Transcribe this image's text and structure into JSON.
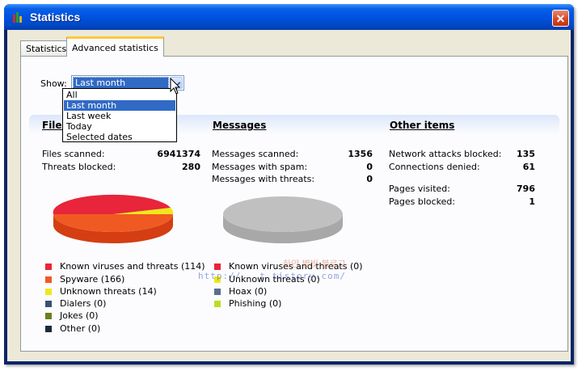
{
  "window": {
    "title": "Statistics"
  },
  "tabs": [
    {
      "label": "Statistics"
    },
    {
      "label": "Advanced statistics"
    }
  ],
  "show": {
    "label": "Show:",
    "selected": "Last month",
    "options": [
      "All",
      "Last month",
      "Last week",
      "Today",
      "Selected dates"
    ]
  },
  "columns": {
    "files": {
      "title": "Files",
      "rows": [
        {
          "label": "Files scanned:",
          "value": "6941374"
        },
        {
          "label": "Threats blocked:",
          "value": "280"
        }
      ],
      "legend": [
        {
          "label": "Known viruses and threats (114)",
          "color": "#e8253a",
          "value": 114
        },
        {
          "label": "Spyware (166)",
          "color": "#f05a22",
          "value": 166
        },
        {
          "label": "Unknown threats (14)",
          "color": "#f0e81a",
          "value": 14
        },
        {
          "label": "Dialers (0)",
          "color": "#3a5070",
          "value": 0
        },
        {
          "label": "Jokes (0)",
          "color": "#6b7f1a",
          "value": 0
        },
        {
          "label": "Other (0)",
          "color": "#1a2a3a",
          "value": 0
        }
      ]
    },
    "messages": {
      "title": "Messages",
      "rows": [
        {
          "label": "Messages scanned:",
          "value": "1356"
        },
        {
          "label": "Messages with spam:",
          "value": "0"
        },
        {
          "label": "Messages with threats:",
          "value": "0"
        }
      ],
      "legend": [
        {
          "label": "Known viruses and threats (0)",
          "color": "#e8253a",
          "value": 0
        },
        {
          "label": "Unknown threats (0)",
          "color": "#f0e81a",
          "value": 0
        },
        {
          "label": "Hoax (0)",
          "color": "#5a6f8f",
          "value": 0
        },
        {
          "label": "Phishing (0)",
          "color": "#b8e020",
          "value": 0
        }
      ]
    },
    "other": {
      "title": "Other items",
      "rows": [
        {
          "label": "Network attacks blocked:",
          "value": "135"
        },
        {
          "label": "Connections denied:",
          "value": "61"
        },
        {
          "label": "Pages visited:",
          "value": "796"
        },
        {
          "label": "Pages blocked:",
          "value": "1"
        }
      ]
    }
  },
  "watermark": {
    "line1": "하얀 별빛 블로그",
    "line2": "http://...t.tistory.com/"
  }
}
